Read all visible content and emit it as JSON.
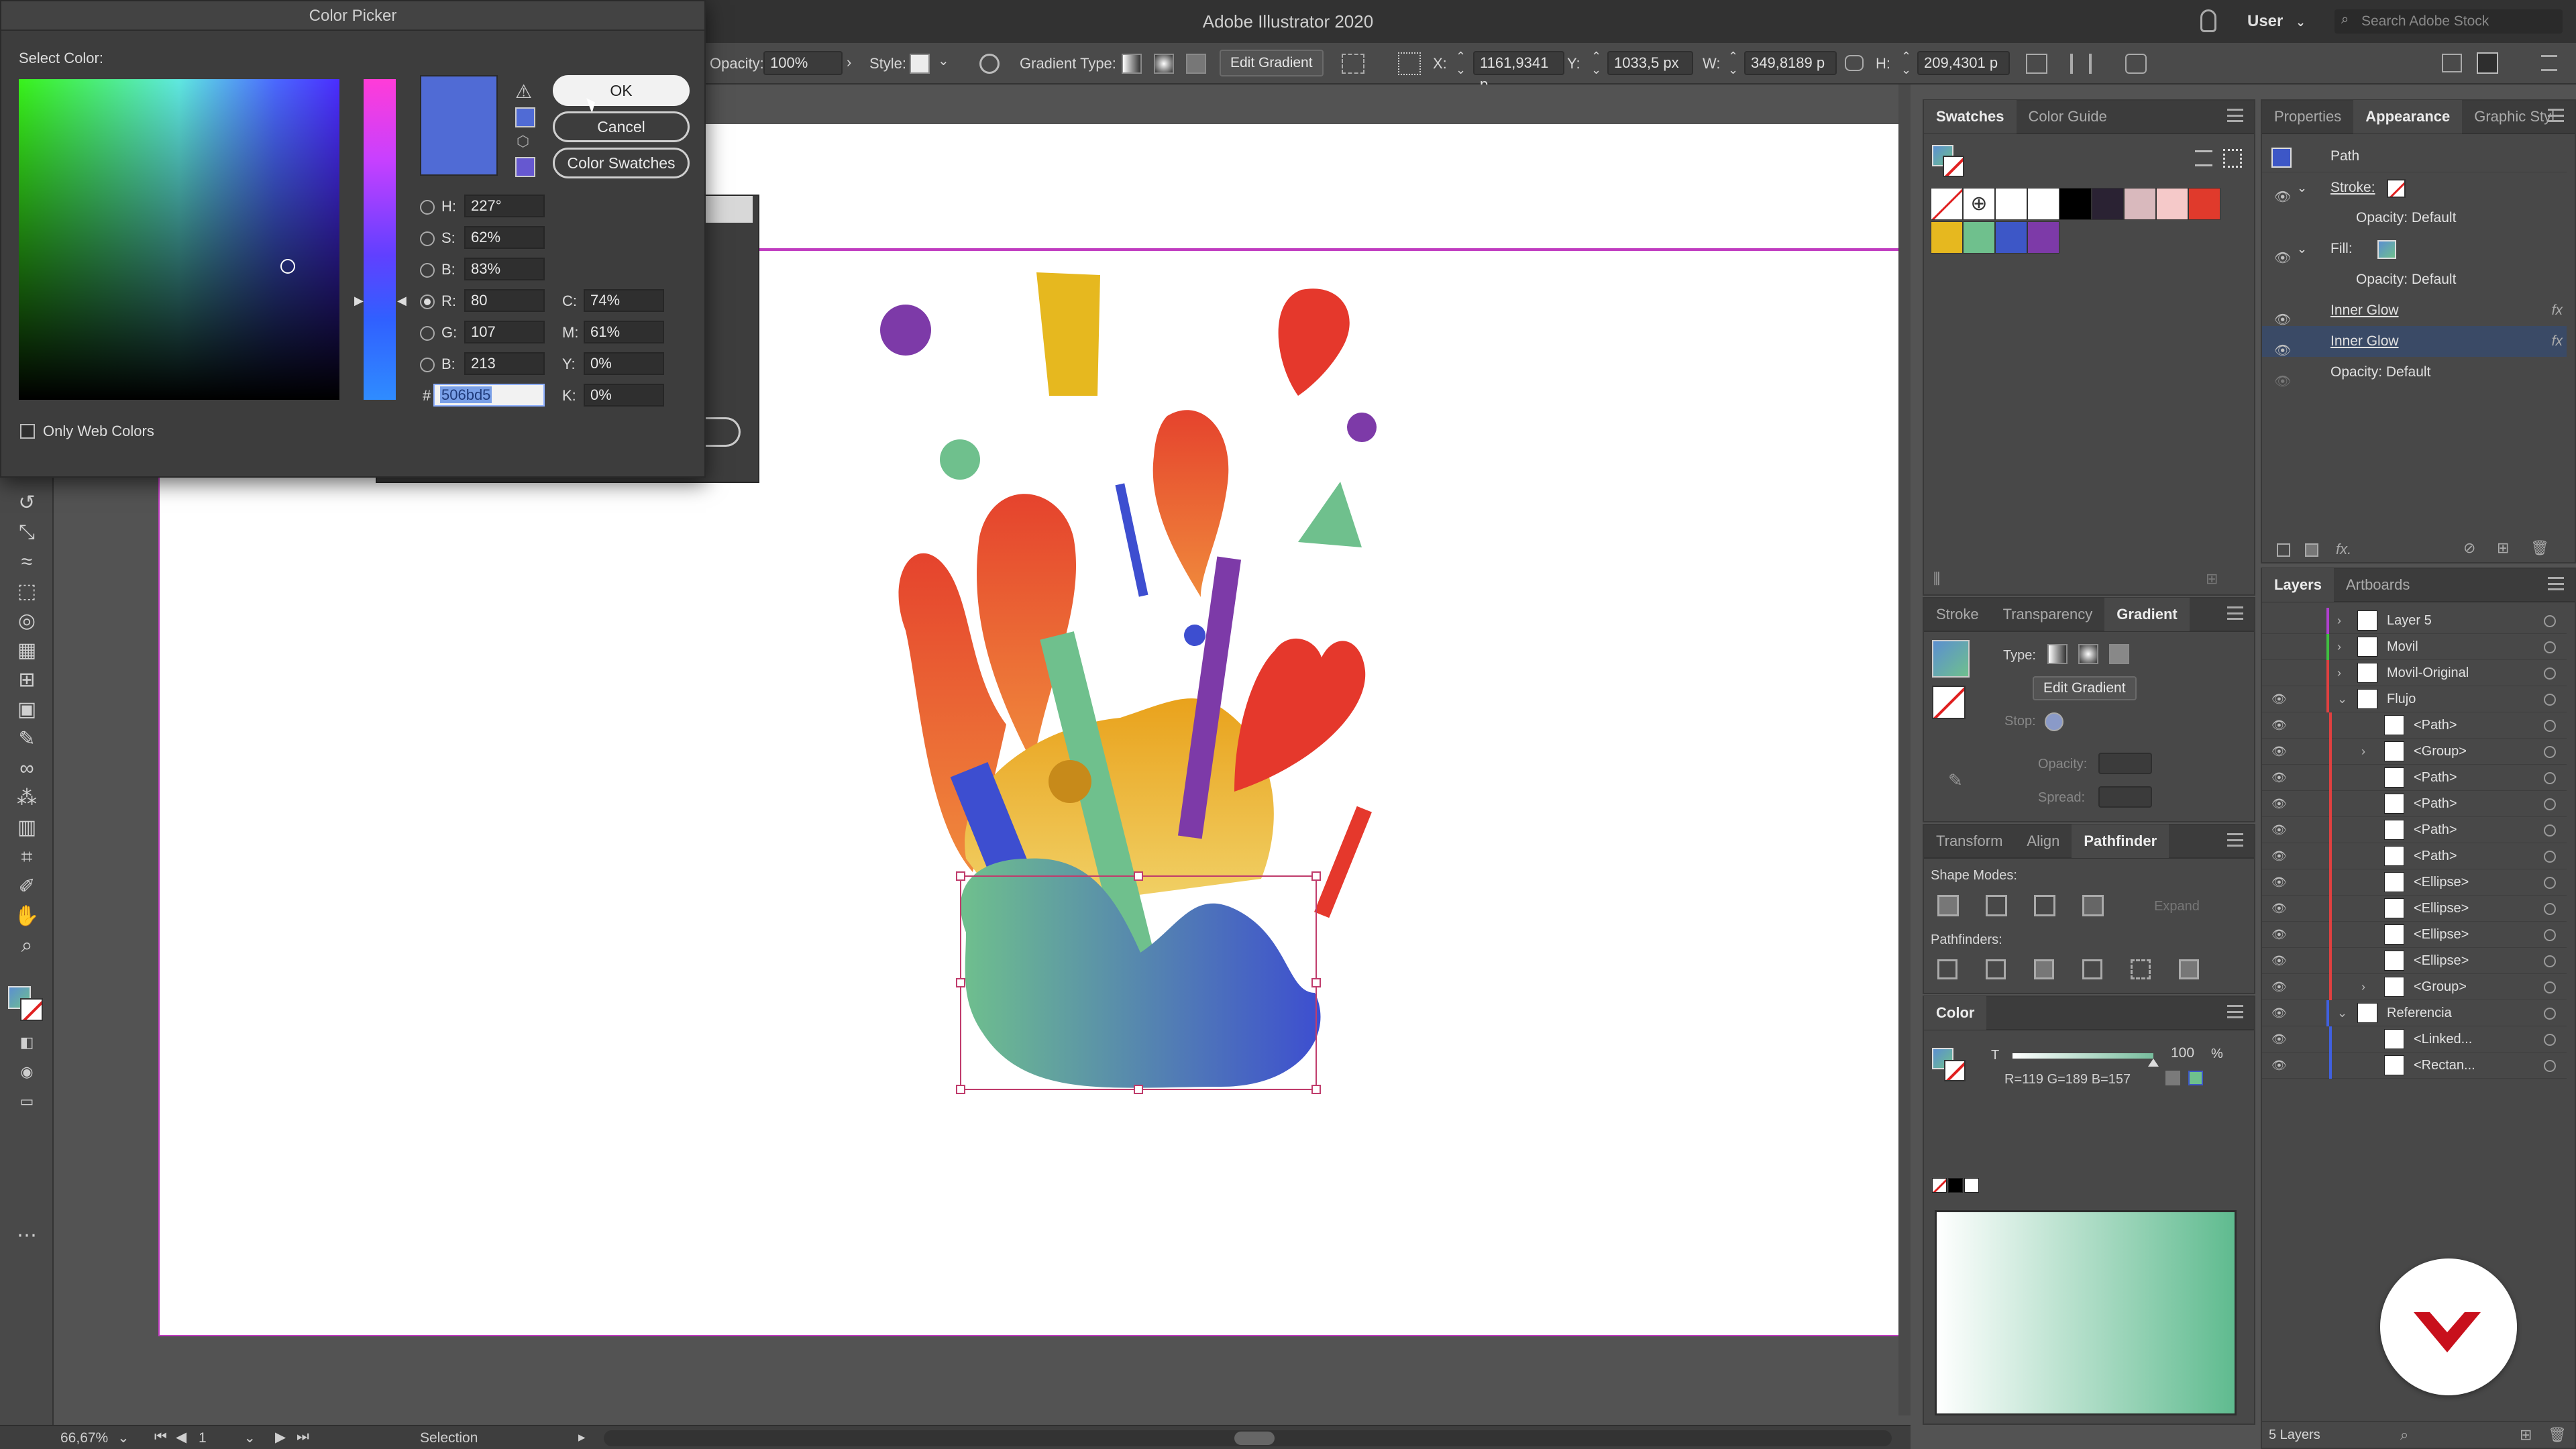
{
  "app": {
    "title": "Adobe Illustrator 2020",
    "workspace": "User",
    "search_placeholder": "Search Adobe Stock"
  },
  "control_bar": {
    "opacity_label": "Opacity:",
    "opacity_value": "100%",
    "style_label": "Style:",
    "gradient_type_label": "Gradient Type:",
    "edit_gradient_label": "Edit Gradient",
    "x_label": "X:",
    "x_value": "1161,9341 p",
    "y_label": "Y:",
    "y_value": "1033,5 px",
    "w_label": "W:",
    "w_value": "349,8189 p",
    "h_label": "H:",
    "h_value": "209,4301 p"
  },
  "color_picker": {
    "title": "Color Picker",
    "select_label": "Select Color:",
    "ok": "OK",
    "cancel": "Cancel",
    "swatches": "Color Swatches",
    "h_label": "H:",
    "h": "227°",
    "s_label": "S:",
    "s": "62%",
    "b_label": "B:",
    "b": "83%",
    "r_label": "R:",
    "r": "80",
    "g_label": "G:",
    "g": "107",
    "bl_label": "B:",
    "bl": "213",
    "c_label": "C:",
    "c": "74%",
    "m_label": "M:",
    "m": "61%",
    "y_label": "Y:",
    "y": "0%",
    "k_label": "K:",
    "k": "0%",
    "hash": "#",
    "hex": "506bd5",
    "web_only": "Only Web Colors",
    "current_color": "#506bd5"
  },
  "swatches_panel": {
    "tabs": [
      "Swatches",
      "Color Guide"
    ],
    "colors": [
      "#ffffff",
      "#ffffff",
      "#000000",
      "#2a2233",
      "#d9b9bd",
      "#f5c9c9",
      "#e03a2c",
      "#e6b81f",
      "#6fc08d",
      "#3d57c7",
      "#7d3aa8"
    ]
  },
  "gradient_panel": {
    "tabs": [
      "Stroke",
      "Transparency",
      "Gradient"
    ],
    "type_label": "Type:",
    "edit_gradient": "Edit Gradient",
    "stop_label": "Stop:",
    "opacity_label": "Opacity:",
    "spread_label": "Spread:"
  },
  "pathfinder_panel": {
    "tabs": [
      "Transform",
      "Align",
      "Pathfinder"
    ],
    "shape_modes": "Shape Modes:",
    "expand": "Expand",
    "pathfinders": "Pathfinders:"
  },
  "color_panel": {
    "tab": "Color",
    "t_label": "T",
    "value": "100",
    "percent": "%",
    "readout": "R=119 G=189 B=157"
  },
  "appearance_panel": {
    "tabs": [
      "Properties",
      "Appearance",
      "Graphic Styl"
    ],
    "path": "Path",
    "stroke": "Stroke:",
    "fill": "Fill:",
    "opacity_default": "Opacity: Default",
    "inner_glow_1": "Inner Glow",
    "inner_glow_2": "Inner Glow",
    "fx": "fx"
  },
  "layers_panel": {
    "tabs": [
      "Layers",
      "Artboards"
    ],
    "count": "5 Layers",
    "rows": [
      {
        "label": "Layer 5",
        "color": "#b040d0"
      },
      {
        "label": "Movil",
        "color": "#40c040"
      },
      {
        "label": "Movil-Original",
        "color": "#e04040"
      },
      {
        "label": "Flujo",
        "color": "#e04040"
      },
      {
        "label": "<Path>",
        "color": "#e04040"
      },
      {
        "label": "<Group>",
        "color": "#e04040"
      },
      {
        "label": "<Path>",
        "color": "#e04040"
      },
      {
        "label": "<Path>",
        "color": "#e04040"
      },
      {
        "label": "<Path>",
        "color": "#e04040"
      },
      {
        "label": "<Path>",
        "color": "#e04040"
      },
      {
        "label": "<Ellipse>",
        "color": "#e04040"
      },
      {
        "label": "<Ellipse>",
        "color": "#e04040"
      },
      {
        "label": "<Ellipse>",
        "color": "#e04040"
      },
      {
        "label": "<Ellipse>",
        "color": "#e04040"
      },
      {
        "label": "<Group>",
        "color": "#e04040"
      },
      {
        "label": "Referencia",
        "color": "#4060e0"
      },
      {
        "label": "<Linked...",
        "color": "#4060e0"
      },
      {
        "label": "<Rectan...",
        "color": "#4060e0"
      }
    ]
  },
  "status_bar": {
    "zoom": "66,67%",
    "artboard": "1",
    "tool": "Selection"
  }
}
